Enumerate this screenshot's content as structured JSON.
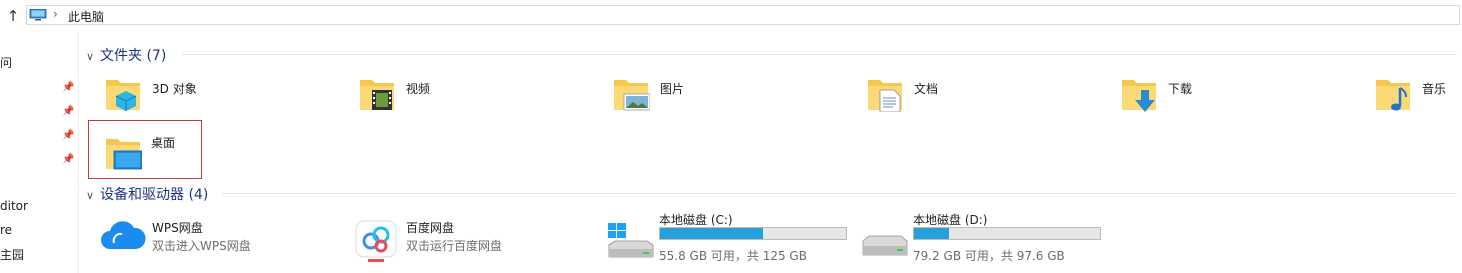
{
  "address": {
    "location": "此电脑"
  },
  "nav": {
    "fragments": [
      "问",
      "ditor",
      "re",
      "主园"
    ]
  },
  "sections": {
    "folders": {
      "title": "文件夹 (7)"
    },
    "devices": {
      "title": "设备和驱动器 (4)"
    }
  },
  "folders": [
    {
      "name": "3D 对象",
      "icon": "3d-objects-folder-icon"
    },
    {
      "name": "视频",
      "icon": "videos-folder-icon"
    },
    {
      "name": "图片",
      "icon": "pictures-folder-icon"
    },
    {
      "name": "文档",
      "icon": "documents-folder-icon"
    },
    {
      "name": "下载",
      "icon": "downloads-folder-icon"
    },
    {
      "name": "音乐",
      "icon": "music-folder-icon"
    },
    {
      "name": "桌面",
      "icon": "desktop-folder-icon"
    }
  ],
  "devices": [
    {
      "name": "WPS网盘",
      "subtitle": "双击进入WPS网盘",
      "icon": "wps-cloud-icon"
    },
    {
      "name": "百度网盘",
      "subtitle": "双击运行百度网盘",
      "icon": "baidu-netdisk-icon"
    },
    {
      "name": "本地磁盘 (C:)",
      "free_text": "55.8 GB 可用，共 125 GB",
      "used_fraction": 0.554,
      "icon": "windows-drive-icon"
    },
    {
      "name": "本地磁盘 (D:)",
      "free_text": "79.2 GB 可用，共 97.6 GB",
      "used_fraction": 0.189,
      "icon": "drive-icon"
    }
  ],
  "colors": {
    "accent": "#1e3287",
    "bar_fill": "#26a0da",
    "selection_border": "#c73a3a"
  }
}
